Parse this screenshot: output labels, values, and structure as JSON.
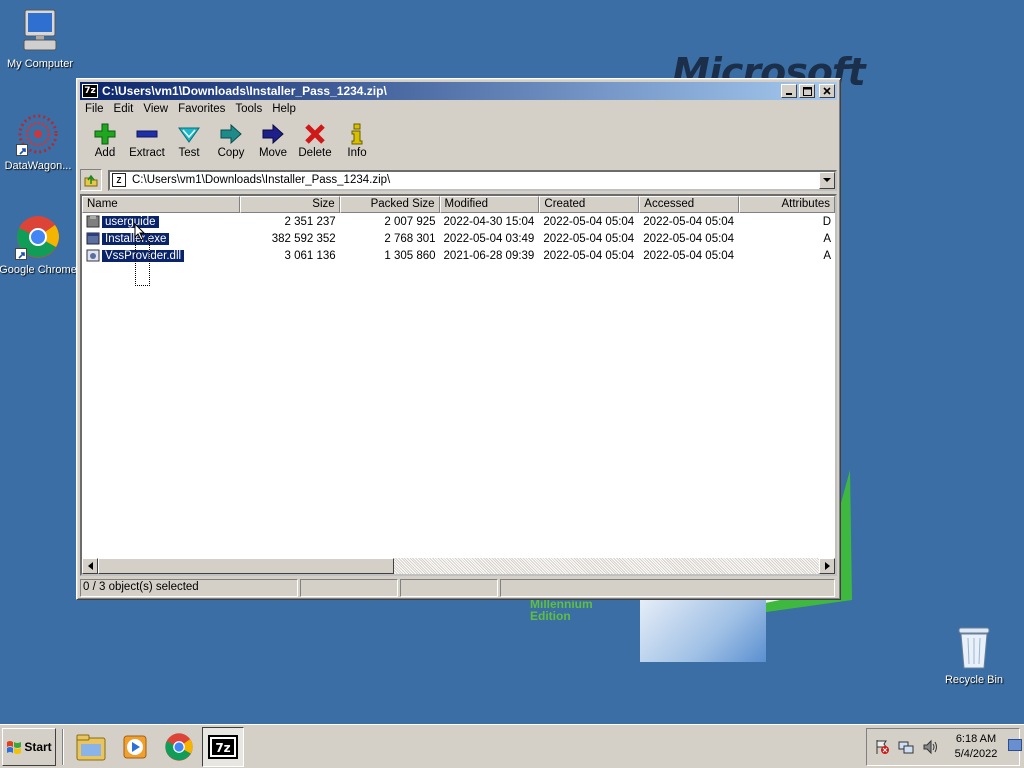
{
  "desktop": {
    "wallpaper_logo": "Microsoft",
    "wallpaper_edition_lines": [
      "Millennium",
      "Edition"
    ],
    "icons": [
      {
        "label": "My Computer",
        "icon": "computer-icon"
      },
      {
        "label": "DataWagon...",
        "icon": "datawagon-icon"
      },
      {
        "label": "Google Chrome",
        "icon": "chrome-icon"
      },
      {
        "label": "Recycle Bin",
        "icon": "recycle-bin-icon"
      }
    ]
  },
  "window": {
    "title": "C:\\Users\\vm1\\Downloads\\Installer_Pass_1234.zip\\",
    "app_icon_text": "7z",
    "menu": [
      "File",
      "Edit",
      "View",
      "Favorites",
      "Tools",
      "Help"
    ],
    "toolbar": [
      {
        "label": "Add",
        "icon": "add-icon",
        "color": "#1fa81f"
      },
      {
        "label": "Extract",
        "icon": "extract-icon",
        "color": "#1f2fa8"
      },
      {
        "label": "Test",
        "icon": "test-icon",
        "color": "#1fb8c8"
      },
      {
        "label": "Copy",
        "icon": "copy-icon",
        "color": "#1f8a8a"
      },
      {
        "label": "Move",
        "icon": "move-icon",
        "color": "#1f1f8a"
      },
      {
        "label": "Delete",
        "icon": "delete-icon",
        "color": "#d01818"
      },
      {
        "label": "Info",
        "icon": "info-icon",
        "color": "#d8c000"
      }
    ],
    "address": "C:\\Users\\vm1\\Downloads\\Installer_Pass_1234.zip\\",
    "columns": [
      "Name",
      "Size",
      "Packed Size",
      "Modified",
      "Created",
      "Accessed",
      "Attributes"
    ],
    "files": [
      {
        "name": "userguide",
        "type": "folder",
        "size": "2 351 237",
        "packed": "2 007 925",
        "modified": "2022-04-30 15:04",
        "created": "2022-05-04 05:04",
        "accessed": "2022-05-04 05:04",
        "attributes": "D"
      },
      {
        "name": "Installer.exe",
        "type": "exe",
        "size": "382 592 352",
        "packed": "2 768 301",
        "modified": "2022-05-04 03:49",
        "created": "2022-05-04 05:04",
        "accessed": "2022-05-04 05:04",
        "attributes": "A"
      },
      {
        "name": "VssProvider.dll",
        "type": "dll",
        "size": "3 061 136",
        "packed": "1 305 860",
        "modified": "2021-06-28 09:39",
        "created": "2022-05-04 05:04",
        "accessed": "2022-05-04 05:04",
        "attributes": "A"
      }
    ],
    "status": "0 / 3 object(s) selected"
  },
  "taskbar": {
    "start_label": "Start",
    "apps": [
      "explorer-icon",
      "media-player-icon",
      "chrome-icon",
      "7zip-icon"
    ],
    "time": "6:18 AM",
    "date": "5/4/2022"
  }
}
